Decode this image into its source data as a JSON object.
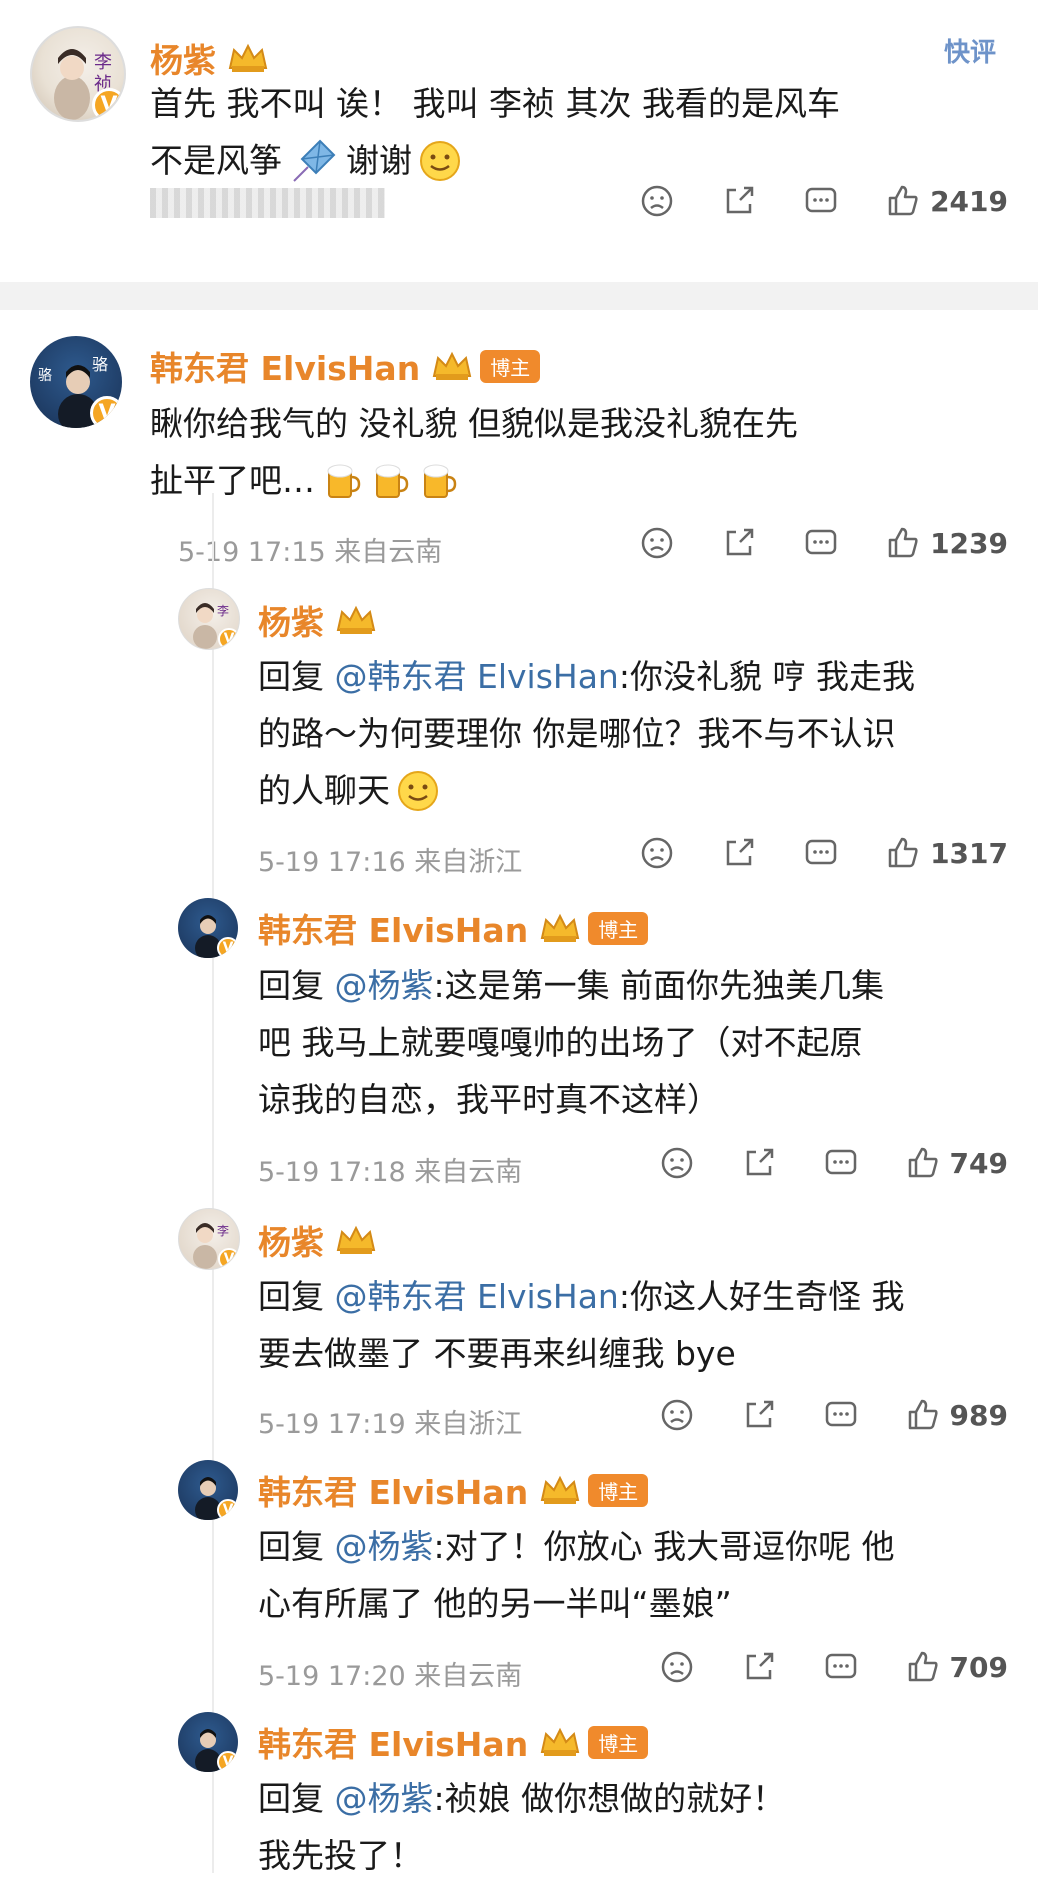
{
  "top_comment": {
    "quick_reply": "快评",
    "user": "杨紫",
    "text_line1": "首先 我不叫 诶！ 我叫 李祯 其次 我看的是风车",
    "text_line2_a": "不是风筝",
    "text_line2_b": "谢谢",
    "like_count": "2419"
  },
  "main_comment": {
    "user": "韩东君 ElvisHan",
    "badge": "博主",
    "text_line1": "瞅你给我气的  没礼貌   但貌似是我没礼貌在先",
    "text_line2": "扯平了吧…",
    "meta": "5-19 17:15  来自云南",
    "like_count": "1239"
  },
  "replies": [
    {
      "user": "杨紫",
      "lines": [
        "回复 @韩东君 ElvisHan:你没礼貌 哼 我走我",
        "的路～为何要理你 你是哪位？我不与不认识",
        "的人聊天"
      ],
      "mention": "@韩东君 ElvisHan",
      "meta": "5-19 17:16  来自浙江",
      "like_count": "1317"
    },
    {
      "user": "韩东君 ElvisHan",
      "badge": "博主",
      "lines": [
        "回复 @杨紫:这是第一集  前面你先独美几集",
        "吧   我马上就要嘎嘎帅的出场了（对不起原",
        "谅我的自恋，我平时真不这样）"
      ],
      "meta": "5-19 17:18  来自云南",
      "like_count": "749"
    },
    {
      "user": "杨紫",
      "lines": [
        "回复 @韩东君 ElvisHan:你这人好生奇怪 我",
        "要去做墨了 不要再来纠缠我 bye"
      ],
      "meta": "5-19 17:19  来自浙江",
      "like_count": "989"
    },
    {
      "user": "韩东君 ElvisHan",
      "badge": "博主",
      "lines": [
        "回复 @杨紫:对了！你放心 我大哥逗你呢  他",
        "心有所属了  他的另一半叫“墨娘”"
      ],
      "meta": "5-19 17:20  来自云南",
      "like_count": "709"
    },
    {
      "user": "韩东君 ElvisHan",
      "badge": "博主",
      "lines": [
        "回复 @杨紫:祯娘  做你想做的就好！",
        "我先投了！"
      ],
      "meta": "",
      "like_count": ""
    }
  ],
  "colors": {
    "name": "#e8862a",
    "mention": "#3b6ea5",
    "meta": "#9a9a9a",
    "separator": "#f2f2f2"
  },
  "icons": [
    "crown-icon",
    "emoji-smile-icon",
    "kite-icon",
    "beer-icon",
    "dislike-icon",
    "share-icon",
    "comment-icon",
    "like-icon",
    "verified-icon"
  ]
}
